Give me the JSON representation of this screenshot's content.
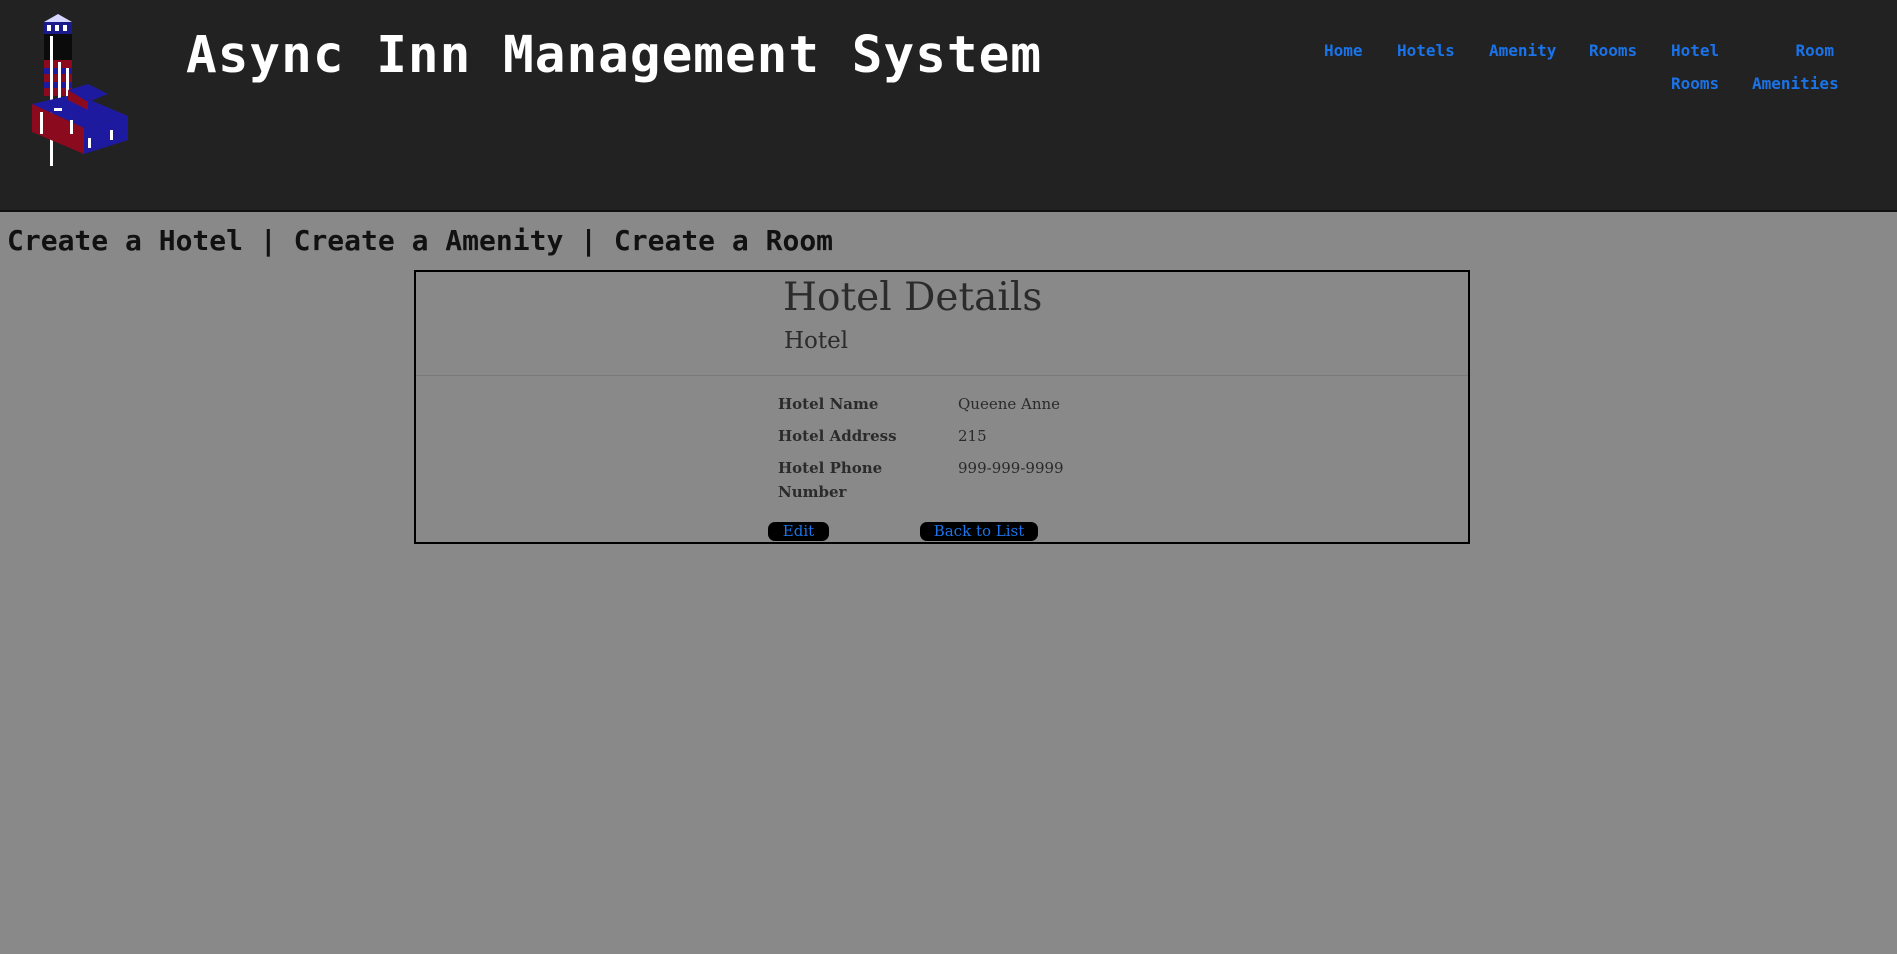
{
  "header": {
    "title": "Async Inn Management System",
    "logo_icon": "hotel-tower-logo",
    "nav": {
      "home": "Home",
      "hotels": "Hotels",
      "amenity": "Amenity",
      "rooms": "Rooms",
      "hotel_rooms_line1": "Hotel",
      "hotel_rooms_line2": "Rooms",
      "room_amenities_line1": "Room",
      "room_amenities_line2": "Amenities"
    }
  },
  "quick_links": {
    "create_hotel": "Create a Hotel",
    "create_amenity": "Create a Amenity",
    "create_room": "Create a Room",
    "separator": "|"
  },
  "details": {
    "title": "Hotel Details",
    "subtitle": "Hotel",
    "fields": [
      {
        "label": "Hotel Name",
        "value": "Queene Anne"
      },
      {
        "label": "Hotel Address",
        "value": "215"
      },
      {
        "label": "Hotel Phone Number",
        "value": "999-999-9999"
      }
    ],
    "edit_label": "Edit",
    "back_label": "Back to List"
  },
  "colors": {
    "page_background": "#898989",
    "header_background": "#222222",
    "link": "#1a73e8",
    "button_background": "#000000"
  }
}
